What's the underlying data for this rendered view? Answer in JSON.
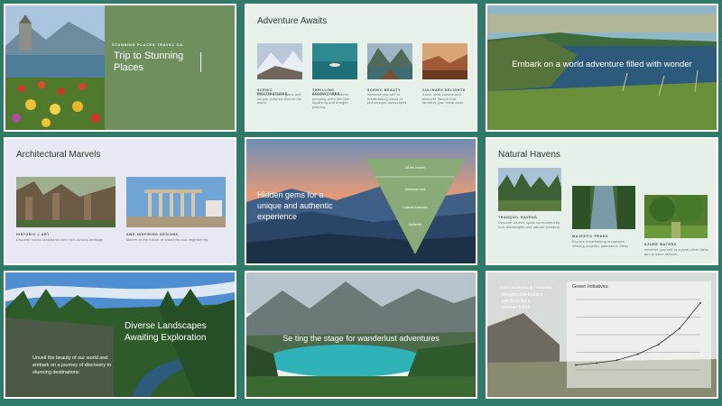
{
  "slides": {
    "s1": {
      "kicker": "STUNNING PLACES TRAVEL CO.",
      "title_l1": "Trip to Stunning",
      "title_l2": "Places"
    },
    "s2": {
      "title": "Adventure Awaits",
      "cards": [
        {
          "label": "SCENIC DESTINATIONS",
          "text": "Discover hidden gems and unique cultures around the world"
        },
        {
          "label": "THRILLING ADVENTURES",
          "text": "Embark on adrenaline-pumping activities like skydiving and bungee jumping"
        },
        {
          "label": "SCENIC BEAUTY",
          "text": "Immerse yourself in breathtaking views of picturesque landscapes"
        },
        {
          "label": "CULINARY DELIGHTS",
          "text": "Savor local cuisine and discover flavors that tantalize your taste buds"
        }
      ]
    },
    "s3": {
      "text": "Embark on a world adventure filled with wonder"
    },
    "s4": {
      "title": "Architectural Marvels",
      "cards": [
        {
          "label": "HISTORIC L ART",
          "text": "Discover iconic landmarks with rich cultural heritage"
        },
        {
          "label": "AWE-INSPIRING DESIGNS",
          "text": "Marvel at the fusion of creativity and engineering"
        }
      ]
    },
    "s5": {
      "text_l1": "Hidden gems for a",
      "text_l2": "unique and authentic",
      "text_l3": "experience",
      "funnel": [
        "Off-the-beaten",
        "Seasonal local",
        "Cultural treasures",
        "Authentic"
      ]
    },
    "s6": {
      "title": "Natural Havens",
      "cards": [
        {
          "label": "TRANQUIL HAVENS",
          "text": "Discover serene spots surrounded by lush landscapes and natural wonders"
        },
        {
          "label": "MAJESTIC PEAKS",
          "text": "Explore breathtaking mountains offering majestic panoramic views"
        },
        {
          "label": "AZURE WATERS",
          "text": "Immerse yourself in crystal-clear lakes and pristine oceans"
        }
      ]
    },
    "s7": {
      "title_l1": "Diverse Landscapes",
      "title_l2": "Awaiting Exploration",
      "body_l1": "Unveil the beauty of our world and",
      "body_l2": "embark on a journey of discovery to",
      "body_l3": "stunning destinations"
    },
    "s8": {
      "text": "Se  ting the stage for wanderlust adventures"
    },
    "s9": {
      "kicker": "SUSTAINABLE TRAVEL",
      "body_l1": "Responsible tourism",
      "body_l2": "practices for a",
      "body_l3": "greener future",
      "chart_title": "Green Initiatives"
    }
  },
  "chart_data": {
    "type": "line",
    "title": "Green Initiatives",
    "x": [
      1,
      2,
      3,
      4,
      5,
      6,
      7
    ],
    "series": [
      {
        "values": [
          5,
          7,
          10,
          16,
          26,
          42,
          68
        ]
      }
    ],
    "grid": true
  },
  "colors": {
    "background": "#2f7a68",
    "accent_green": "#6f8f5e",
    "funnel_green": "#8aaa78"
  }
}
